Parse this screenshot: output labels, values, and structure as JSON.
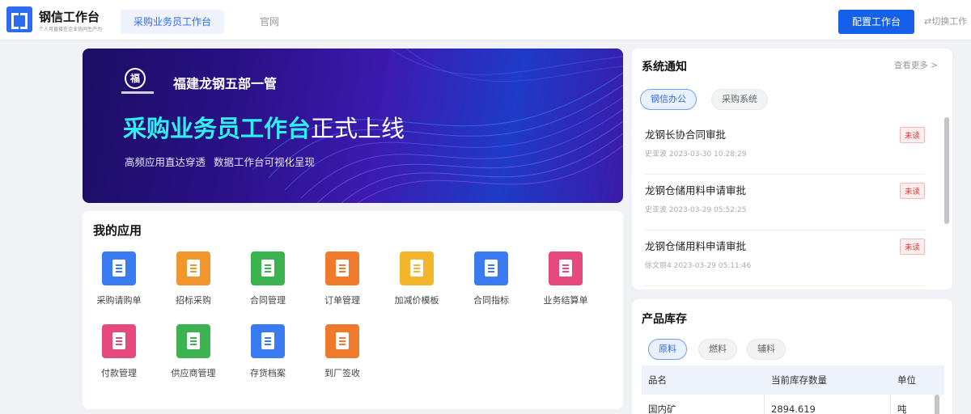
{
  "header": {
    "brand": "钢信工作台",
    "brand_sub": "个人可直接在企业协同生产力",
    "tabs": [
      {
        "label": "采购业务员工作台",
        "active": true
      },
      {
        "label": "官网",
        "active": false
      }
    ],
    "config_button": "配置工作台",
    "switch_link": "⇄切换工作"
  },
  "banner": {
    "emblem": "福",
    "company": "福建龙钢五部一管",
    "title_highlight": "采购业务员工作台",
    "title_rest": "正式上线",
    "subtitle": "高频应用直达穿透 数据工作台可视化呈现"
  },
  "apps": {
    "title": "我的应用",
    "items": [
      {
        "label": "采购请购单",
        "color": "#3a7bf2",
        "icon": "edit-doc-icon"
      },
      {
        "label": "招标采购",
        "color": "#f0962d",
        "icon": "clipboard-icon"
      },
      {
        "label": "合同管理",
        "color": "#3cb250",
        "icon": "contract-icon"
      },
      {
        "label": "订单管理",
        "color": "#ef7a2c",
        "icon": "order-icon"
      },
      {
        "label": "加减价模板",
        "color": "#f2b52c",
        "icon": "template-icon"
      },
      {
        "label": "合同指标",
        "color": "#3a7bf2",
        "icon": "chart-icon"
      },
      {
        "label": "业务结算单",
        "color": "#e64a7c",
        "icon": "yen-doc-icon"
      },
      {
        "label": "付款管理",
        "color": "#e64a7c",
        "icon": "payment-icon"
      },
      {
        "label": "供应商管理",
        "color": "#3cb250",
        "icon": "supplier-icon"
      },
      {
        "label": "存货档案",
        "color": "#3a7bf2",
        "icon": "inbox-icon"
      },
      {
        "label": "到厂签收",
        "color": "#ef7a2c",
        "icon": "receipt-icon"
      }
    ]
  },
  "notice": {
    "title": "系统通知",
    "more": "查看更多 >",
    "tabs": [
      {
        "label": "钢信办公",
        "active": true
      },
      {
        "label": "采购系统",
        "active": false
      }
    ],
    "items": [
      {
        "title": "龙钢长协合同审批",
        "meta": "史亚波 2023-03-30 10:28:29",
        "badge": "未读"
      },
      {
        "title": "龙钢仓储用料申请审批",
        "meta": "史亚波 2023-03-29 05:52:25",
        "badge": "未读"
      },
      {
        "title": "龙钢仓储用料申请审批",
        "meta": "徐文丽4 2023-03-29 05:11:46",
        "badge": "未读"
      }
    ]
  },
  "stock": {
    "title": "产品库存",
    "tabs": [
      {
        "label": "原料",
        "active": true
      },
      {
        "label": "燃料",
        "active": false
      },
      {
        "label": "辅料",
        "active": false
      }
    ],
    "columns": [
      "品名",
      "当前库存数量",
      "单位"
    ],
    "rows": [
      [
        "国内矿",
        "2894.619",
        "吨"
      ]
    ]
  }
}
